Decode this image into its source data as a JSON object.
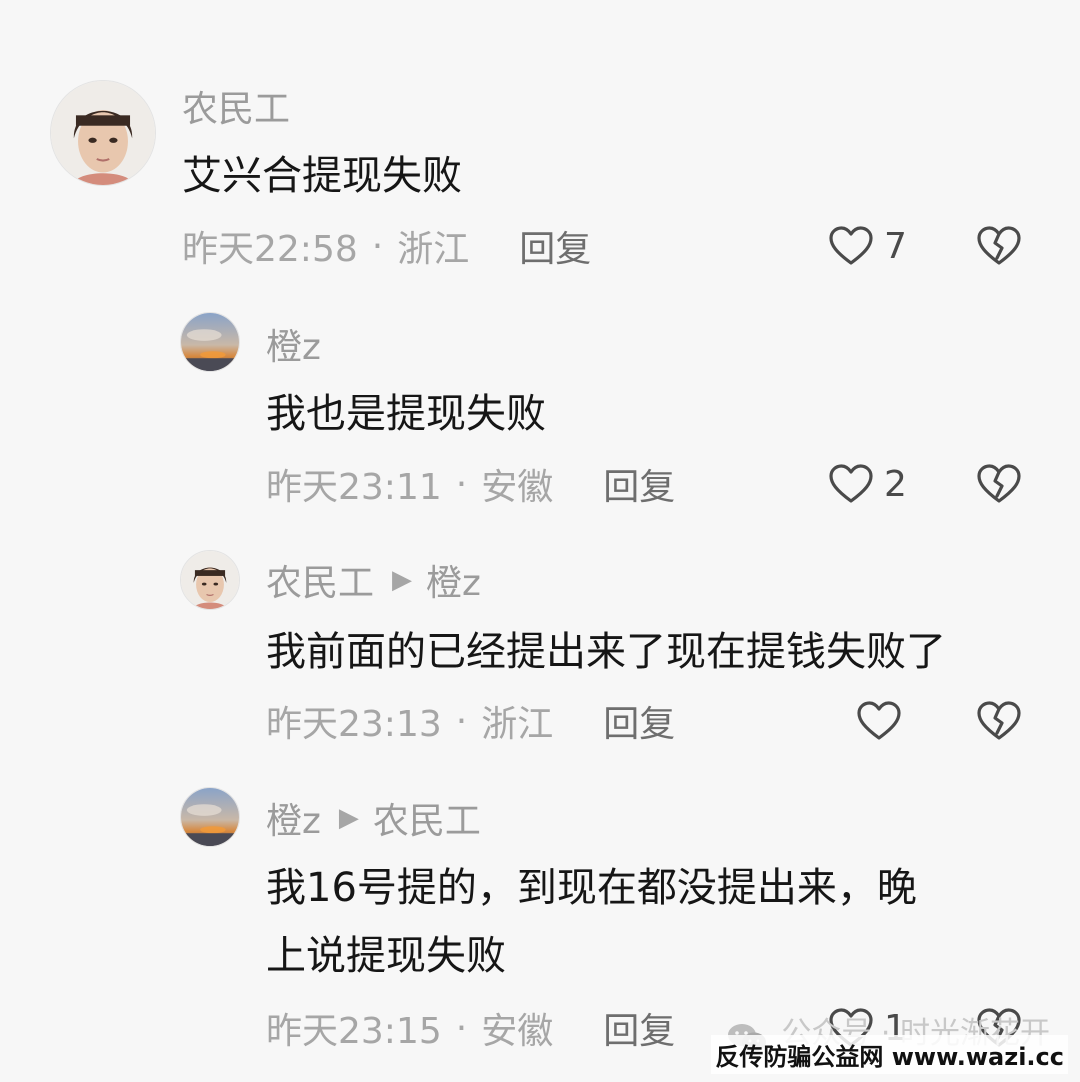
{
  "comments": [
    {
      "author": "农民工",
      "text": "艾兴合提现失败",
      "time": "昨天22:58",
      "location": "浙江",
      "reply_label": "回复",
      "likes": "7"
    },
    {
      "author": "橙z",
      "text": "我也是提现失败",
      "time": "昨天23:11",
      "location": "安徽",
      "reply_label": "回复",
      "likes": "2"
    },
    {
      "author": "农民工",
      "reply_to": "橙z",
      "text": "我前面的已经提出来了现在提钱失败了",
      "time": "昨天23:13",
      "location": "浙江",
      "reply_label": "回复",
      "likes": ""
    },
    {
      "author": "橙z",
      "reply_to": "农民工",
      "text_line1": "我16号提的，到现在都没提出来，晚",
      "text_line2": "上说提现失败",
      "time": "昨天23:15",
      "location": "安徽",
      "reply_label": "回复",
      "likes": "1"
    }
  ],
  "separator": "·",
  "watermark": {
    "account": "公众号 · 时光渐花开",
    "site": "反传防骗公益网 www.wazi.cc"
  },
  "icons": {
    "like": "heart-outline-icon",
    "dislike": "broken-heart-icon",
    "reply_arrow": "right-triangle-icon",
    "wechat": "wechat-icon"
  },
  "colors": {
    "background": "#f7f7f7",
    "meta_text": "#a6a6a6",
    "comment_text": "#161616",
    "icon": "#4a4a4a"
  }
}
